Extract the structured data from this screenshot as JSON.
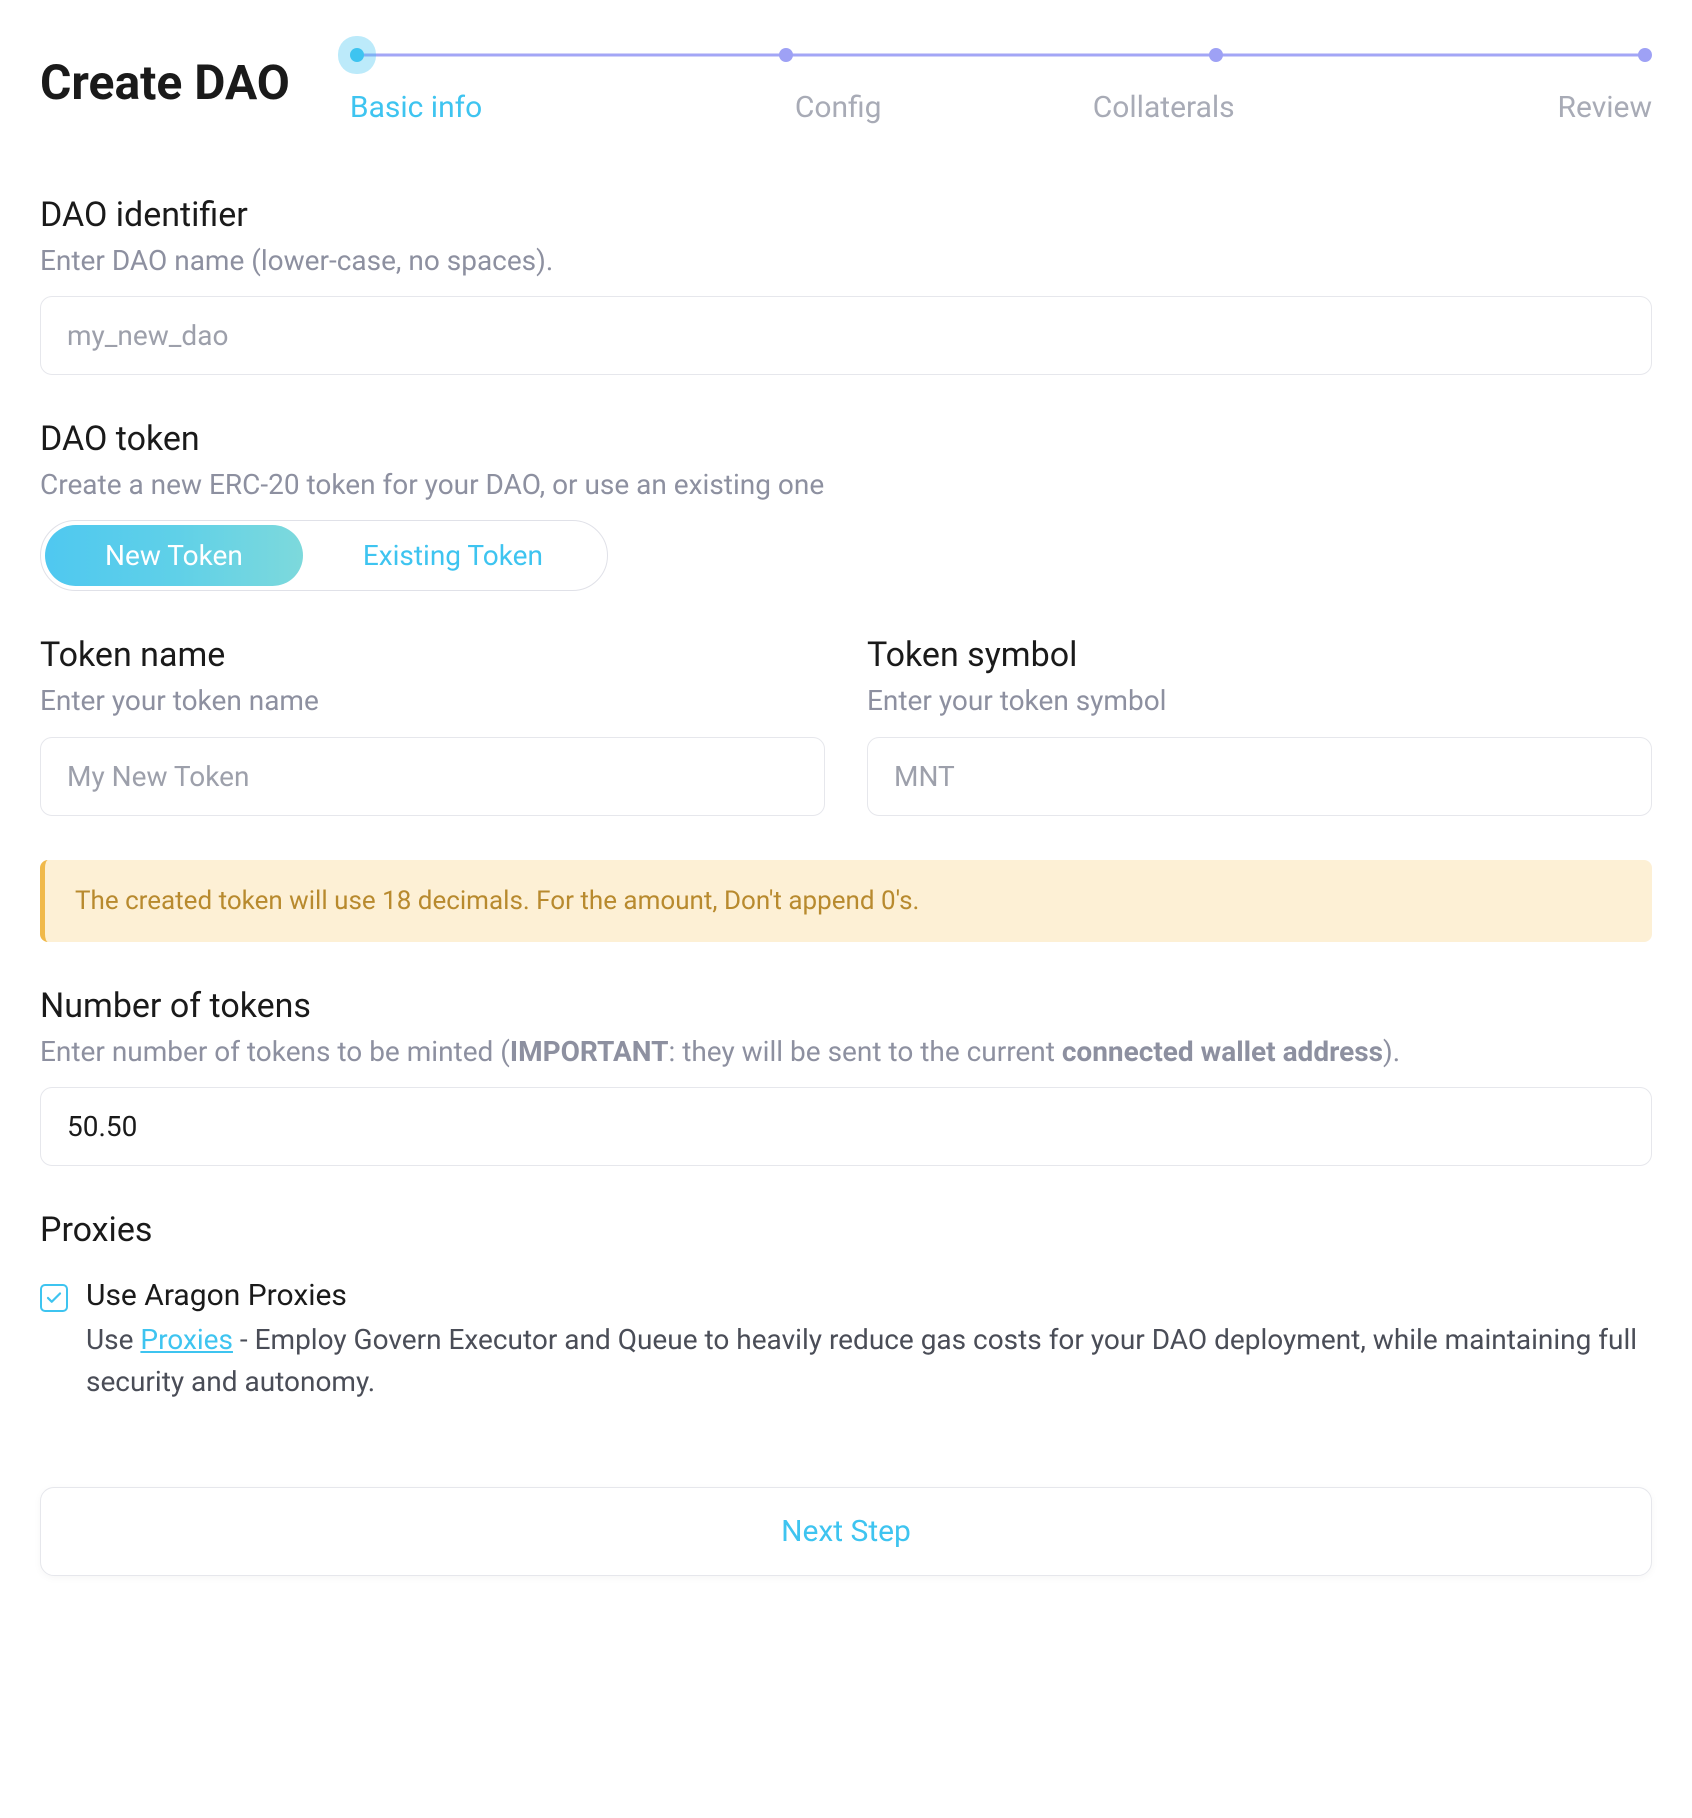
{
  "page": {
    "title": "Create DAO"
  },
  "stepper": {
    "steps": [
      {
        "label": "Basic info",
        "active": true
      },
      {
        "label": "Config",
        "active": false
      },
      {
        "label": "Collaterals",
        "active": false
      },
      {
        "label": "Review",
        "active": false
      }
    ]
  },
  "daoIdentifier": {
    "title": "DAO identifier",
    "subtitle": "Enter DAO name (lower-case, no spaces).",
    "placeholder": "my_new_dao",
    "value": ""
  },
  "daoToken": {
    "title": "DAO token",
    "subtitle": "Create a new ERC-20 token for your DAO, or use an existing one",
    "options": {
      "new": "New Token",
      "existing": "Existing Token"
    }
  },
  "tokenName": {
    "title": "Token name",
    "subtitle": "Enter your token name",
    "placeholder": "My New Token",
    "value": ""
  },
  "tokenSymbol": {
    "title": "Token symbol",
    "subtitle": "Enter your token symbol",
    "placeholder": "MNT",
    "value": ""
  },
  "banner": {
    "text": "The created token will use 18 decimals. For the amount, Don't append 0's."
  },
  "numberOfTokens": {
    "title": "Number of tokens",
    "sub_prefix": "Enter number of tokens to be minted (",
    "sub_important": "IMPORTANT",
    "sub_mid": ": they will be sent to the current ",
    "sub_wallet": "connected wallet address",
    "sub_suffix": ").",
    "value": "50.50"
  },
  "proxies": {
    "title": "Proxies",
    "checkbox_label": "Use Aragon Proxies",
    "desc_prefix": "Use ",
    "desc_link": "Proxies",
    "desc_suffix": " - Employ Govern Executor and Queue to heavily reduce gas costs for your DAO deployment, while maintaining full security and autonomy.",
    "checked": true
  },
  "actions": {
    "next": "Next Step"
  }
}
